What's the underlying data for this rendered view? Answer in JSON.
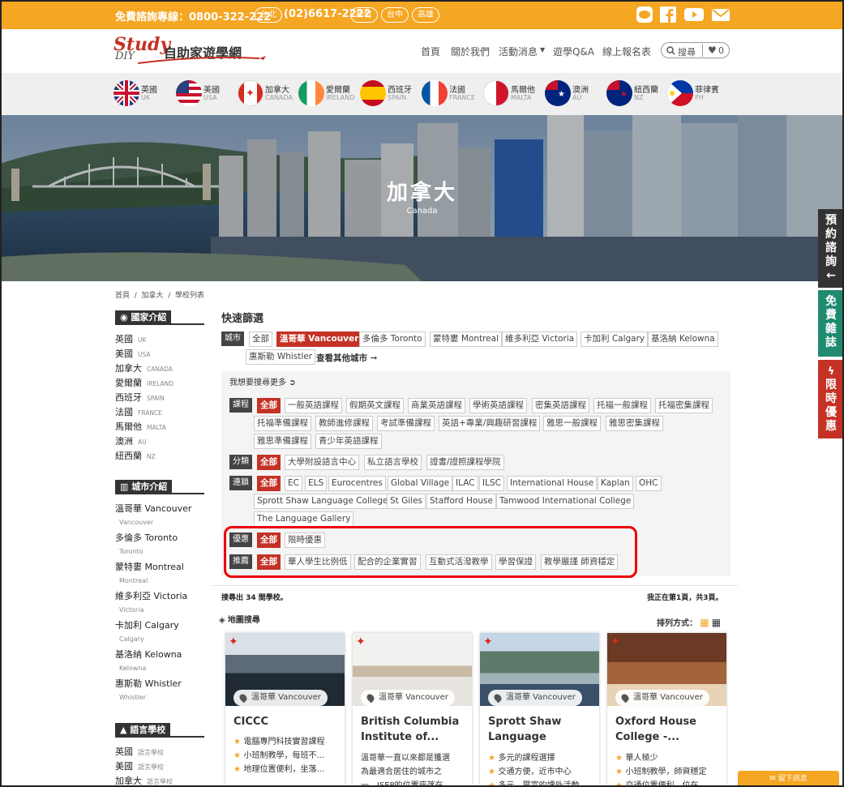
{
  "topbar": {
    "hotline": "免費諮詢專線：0800-322-222",
    "offices": [
      "台北",
      "(02)6617-2222",
      "新竹",
      "台中",
      "高雄"
    ]
  },
  "logo": {
    "brand": "Study",
    "sub": "DIY",
    "zh": "自助家遊學網"
  },
  "nav": {
    "items": [
      "首頁",
      "關於我們",
      "活動消息",
      "遊學Q&A",
      "線上報名表"
    ],
    "search_label": "搜尋",
    "cart_count": "0"
  },
  "flags": [
    {
      "zh": "英國",
      "en": "UK"
    },
    {
      "zh": "美國",
      "en": "USA"
    },
    {
      "zh": "加拿大",
      "en": "CANADA"
    },
    {
      "zh": "愛爾蘭",
      "en": "IRELAND"
    },
    {
      "zh": "西班牙",
      "en": "SPAIN"
    },
    {
      "zh": "法國",
      "en": "FRANCE"
    },
    {
      "zh": "馬爾他",
      "en": "MALTA"
    },
    {
      "zh": "澳洲",
      "en": "AU"
    },
    {
      "zh": "紐西蘭",
      "en": "NZ"
    },
    {
      "zh": "菲律賓",
      "en": "PH"
    }
  ],
  "hero": {
    "title": "加拿大",
    "subtitle": "Canada"
  },
  "side_tabs": [
    {
      "text": "預約諮詢",
      "arrow": "←",
      "color": "#333333"
    },
    {
      "text": "免費雜誌",
      "color": "#1f8a70"
    },
    {
      "text": "限時優惠",
      "color": "#c43225"
    }
  ],
  "breadcrumb": [
    "首頁",
    "加拿大",
    "學校列表"
  ],
  "sidebar": {
    "country_head": "國家介紹",
    "countries": [
      {
        "zh": "英國",
        "en": "UK"
      },
      {
        "zh": "美國",
        "en": "USA"
      },
      {
        "zh": "加拿大",
        "en": "CANADA"
      },
      {
        "zh": "愛爾蘭",
        "en": "IRELAND"
      },
      {
        "zh": "西班牙",
        "en": "SPAIN"
      },
      {
        "zh": "法國",
        "en": "FRANCE"
      },
      {
        "zh": "馬爾他",
        "en": "MALTA"
      },
      {
        "zh": "澳洲",
        "en": "AU"
      },
      {
        "zh": "紐西蘭",
        "en": "NZ"
      }
    ],
    "city_head": "城市介紹",
    "cities": [
      {
        "zh": "溫哥華 Vancouver",
        "en": "Vancouver"
      },
      {
        "zh": "多倫多 Toronto",
        "en": "Toronto"
      },
      {
        "zh": "蒙特婁 Montreal",
        "en": "Montreal"
      },
      {
        "zh": "維多利亞 Victoria",
        "en": "Victoria"
      },
      {
        "zh": "卡加利 Calgary",
        "en": "Calgary"
      },
      {
        "zh": "基洛納 Kelowna",
        "en": "Kelowna"
      },
      {
        "zh": "惠斯勒 Whistler",
        "en": "Whistler"
      }
    ],
    "school_head": "語言學校",
    "schools": [
      {
        "zh": "英國",
        "en": "語言學校"
      },
      {
        "zh": "美國",
        "en": "語言學校"
      },
      {
        "zh": "加拿大",
        "en": "語言學校"
      }
    ]
  },
  "filters": {
    "title": "快速篩選",
    "city_label": "城市",
    "cities": [
      "全部",
      "溫哥華 Vancouver",
      "多倫多 Toronto",
      "蒙特婁 Montreal",
      "維多利亞 Victoria",
      "卡加利 Calgary",
      "基洛納 Kelowna",
      "惠斯勒 Whistler"
    ],
    "more_cities": "查看其他城市 ➞",
    "more_search": "我想要搜尋更多",
    "course_label": "課程",
    "courses": [
      "全部",
      "一般英語課程",
      "假期英文課程",
      "商業英語課程",
      "學術英語課程",
      "密集英語課程",
      "托福一般課程",
      "托福密集課程",
      "托福準備課程",
      "教師進修課程",
      "考試準備課程",
      "英語+專業/興趣研習課程",
      "雅思一般課程",
      "雅思密集課程",
      "雅思準備課程",
      "青少年英語課程"
    ],
    "type_label": "分類",
    "types": [
      "全部",
      "大學附設語言中心",
      "私立語言學校",
      "證書/證照課程學院"
    ],
    "chain_label": "連鎖",
    "chains": [
      "全部",
      "EC",
      "ELS",
      "Eurocentres",
      "Global Village",
      "ILAC",
      "ILSC",
      "International House",
      "Kaplan",
      "OHC",
      "Sprott Shaw Language College",
      "St Giles",
      "Stafford House",
      "Tamwood International College",
      "The Language Gallery"
    ],
    "promo_label": "優惠",
    "promos": [
      "全部",
      "限時優惠"
    ],
    "rec_label": "推薦",
    "recs": [
      "全部",
      "華人學生比例低",
      "配合的企業實習",
      "互動式活潑教學",
      "學習保證",
      "教學嚴謹 師資穩定"
    ]
  },
  "results": {
    "found": "搜尋出 34 間學校。",
    "page": "我正在第1頁，共3頁。",
    "map": "地圖搜尋",
    "sort": "排列方式："
  },
  "cards": [
    {
      "city": "溫哥華 Vancouver",
      "name": "CICCC",
      "lines": [
        "電腦專門科技實習課程",
        "小班制教學，每班不...",
        "地理位置便利，坐落..."
      ],
      "bullets": true
    },
    {
      "city": "溫哥華 Vancouver",
      "name": "British Columbia Institute of...",
      "lines": [
        "溫哥華一直以來都是獲選",
        "為最適合居住的城市之",
        "一，ISEP的位置座落在..."
      ],
      "bullets": false
    },
    {
      "city": "溫哥華 Vancouver",
      "name": "Sprott Shaw Language Colleg...",
      "lines": [
        "多元的課程選擇",
        "交通方便，近市中心",
        "多元、豐富的課外活動"
      ],
      "bullets": true
    },
    {
      "city": "溫哥華 Vancouver",
      "name": "Oxford House College -...",
      "lines": [
        "華人極少",
        "小班制教學，師資穩定",
        "交通位置便利，位在..."
      ],
      "bullets": true
    }
  ],
  "message_tab": "留下訊息"
}
